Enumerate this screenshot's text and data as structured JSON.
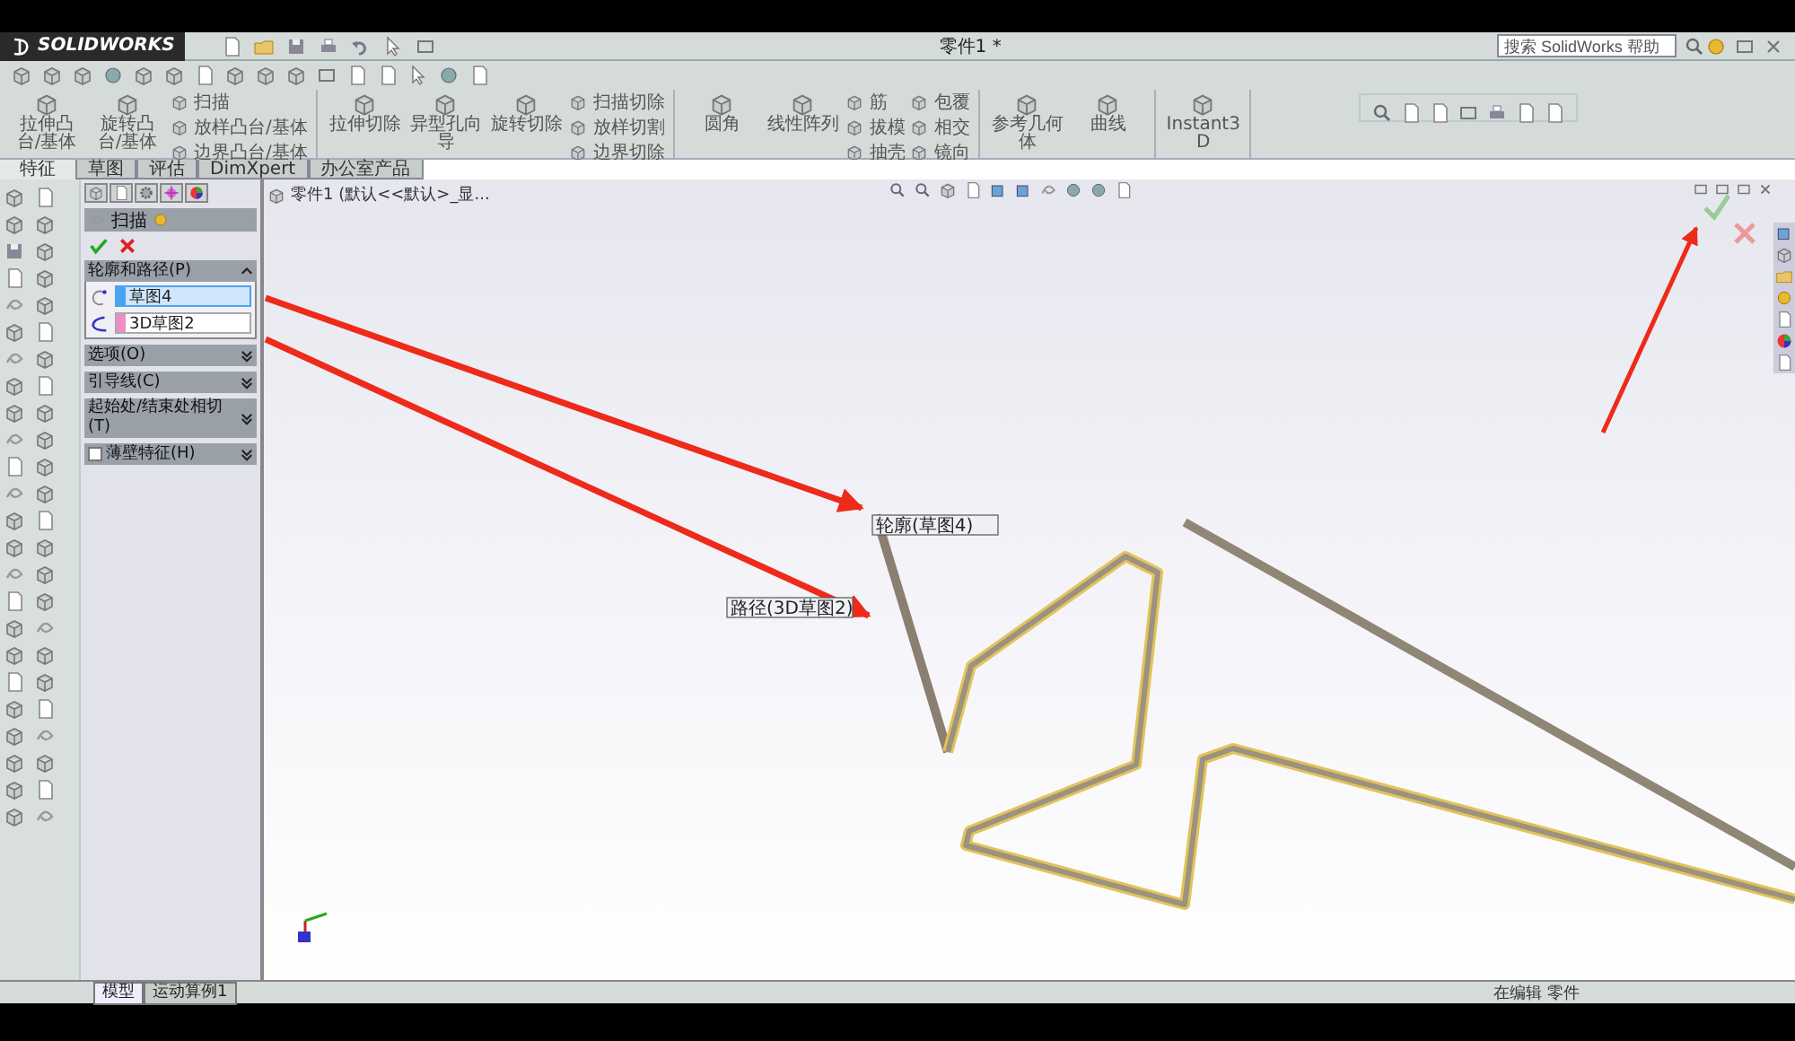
{
  "window": {
    "logo": "SOLIDWORKS",
    "title": "零件1 *"
  },
  "help_search": {
    "placeholder": "搜索 SolidWorks 帮助"
  },
  "command_groups": [
    [
      {
        "kind": "large",
        "label": "拉伸凸台/基体"
      },
      {
        "kind": "large",
        "label": "旋转凸台/基体"
      },
      {
        "kind": "stack",
        "items": [
          "扫描",
          "放样凸台/基体",
          "边界凸台/基体"
        ]
      }
    ],
    [
      {
        "kind": "large",
        "label": "拉伸切除"
      },
      {
        "kind": "large",
        "label": "异型孔向导"
      },
      {
        "kind": "large",
        "label": "旋转切除"
      },
      {
        "kind": "stack",
        "items": [
          "扫描切除",
          "放样切割",
          "边界切除"
        ]
      }
    ],
    [
      {
        "kind": "large",
        "label": "圆角"
      },
      {
        "kind": "large",
        "label": "线性阵列"
      },
      {
        "kind": "stack",
        "items": [
          "筋",
          "拔模",
          "抽壳"
        ]
      },
      {
        "kind": "stack",
        "items": [
          "包覆",
          "相交",
          "镜向"
        ]
      }
    ],
    [
      {
        "kind": "large",
        "label": "参考几何体"
      },
      {
        "kind": "large",
        "label": "曲线"
      }
    ],
    [
      {
        "kind": "large",
        "label": "Instant3D"
      }
    ]
  ],
  "tabs": [
    {
      "label": "特征",
      "selected": true
    },
    {
      "label": "草图",
      "selected": false
    },
    {
      "label": "评估",
      "selected": false
    },
    {
      "label": "DimXpert",
      "selected": false
    },
    {
      "label": "办公室产品",
      "selected": false
    }
  ],
  "feature_tree": {
    "root": "零件1 (默认<<默认>_显..."
  },
  "property_manager": {
    "title": "扫描",
    "sections": [
      {
        "label": "轮廓和路径(P)",
        "expanded": true,
        "fields": [
          {
            "kind": "profile",
            "value": "草图4",
            "selected": true,
            "color": "#4aa3f0"
          },
          {
            "kind": "path",
            "value": "3D草图2",
            "selected": false,
            "color": "#f08cc8"
          }
        ]
      },
      {
        "label": "选项(O)",
        "expanded": false
      },
      {
        "label": "引导线(C)",
        "expanded": false
      },
      {
        "label": "起始处/结束处相切(T)",
        "expanded": false
      },
      {
        "label": "薄壁特征(H)",
        "expanded": false,
        "checked": false
      }
    ]
  },
  "callouts": [
    {
      "text": "轮廓(草图4)"
    },
    {
      "text": "路径(3D草图2)"
    }
  ],
  "bottom_tabs": [
    {
      "label": "模型",
      "selected": true
    },
    {
      "label": "运动算例1",
      "selected": false
    }
  ],
  "status_bar": {
    "text": "在编辑 零件"
  }
}
